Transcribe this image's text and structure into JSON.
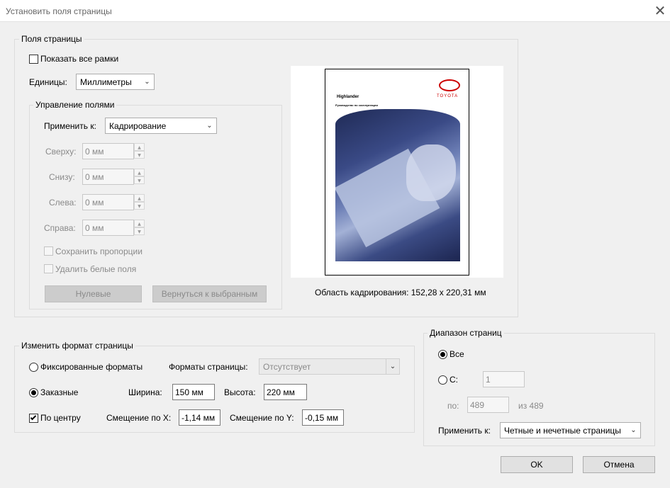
{
  "window": {
    "title": "Установить поля страницы",
    "close_icon": "close-icon"
  },
  "margins_group": {
    "legend": "Поля страницы",
    "show_all_boxes": {
      "label": "Показать все рамки",
      "checked": false
    },
    "units": {
      "label": "Единицы:",
      "value": "Миллиметры"
    },
    "control": {
      "legend": "Управление полями",
      "apply_to": {
        "label": "Применить к:",
        "value": "Кадрирование"
      },
      "top": {
        "label": "Сверху:",
        "value": "0 мм"
      },
      "bottom": {
        "label": "Снизу:",
        "value": "0 мм"
      },
      "left": {
        "label": "Слева:",
        "value": "0 мм"
      },
      "right": {
        "label": "Справа:",
        "value": "0 мм"
      },
      "keep_proportions": {
        "label": "Сохранить пропорции",
        "checked": false
      },
      "remove_white": {
        "label": "Удалить белые поля",
        "checked": false
      },
      "zero_button": "Нулевые",
      "revert_button": "Вернуться к выбранным"
    },
    "preview": {
      "doc_title": "Highlander",
      "doc_subtitle": "Руководство по эксплуатации",
      "brand": "TOYOTA",
      "crop_area": "Область кадрирования: 152,28 x 220,31 мм"
    }
  },
  "page_size_group": {
    "legend": "Изменить формат страницы",
    "fixed": {
      "label": "Фиксированные форматы",
      "selected": false
    },
    "formats": {
      "label": "Форматы страницы:",
      "value": "Отсутствует"
    },
    "custom": {
      "label": "Заказные",
      "selected": true
    },
    "width": {
      "label": "Ширина:",
      "value": "150 мм"
    },
    "height": {
      "label": "Высота:",
      "value": "220 мм"
    },
    "center": {
      "label": "По центру",
      "checked": true
    },
    "offset_x": {
      "label": "Смещение по X:",
      "value": "-1,14 мм"
    },
    "offset_y": {
      "label": "Смещение по Y:",
      "value": "-0,15 мм"
    }
  },
  "page_range_group": {
    "legend": "Диапазон страниц",
    "all": {
      "label": "Все",
      "selected": true
    },
    "from": {
      "label": "С:",
      "value": "1",
      "selected": false
    },
    "to": {
      "label": "по:",
      "value": "489",
      "of": "из 489"
    },
    "apply_to": {
      "label": "Применить к:",
      "value": "Четные и нечетные страницы"
    }
  },
  "buttons": {
    "ok": "OK",
    "cancel": "Отмена"
  }
}
